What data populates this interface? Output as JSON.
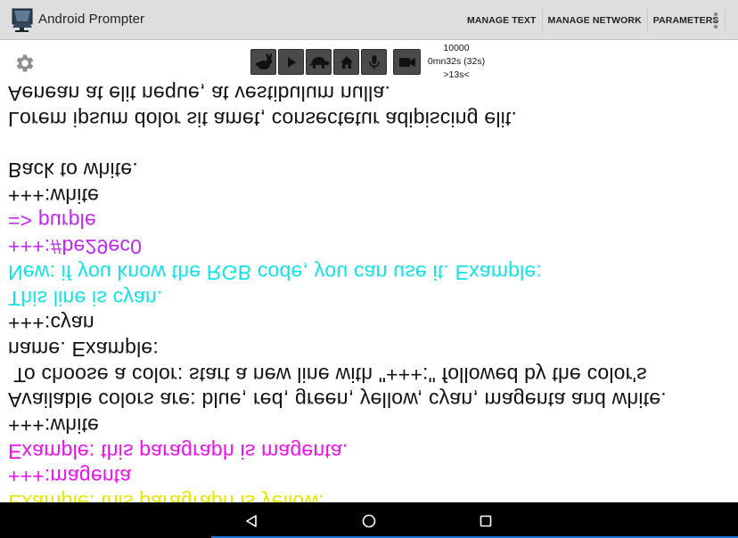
{
  "app": {
    "title": "Android Prompter",
    "icon": "teleprompter-icon"
  },
  "menu": {
    "items": [
      {
        "label": "MANAGE TEXT"
      },
      {
        "label": "MANAGE NETWORK"
      },
      {
        "label": "PARAMETERS"
      }
    ],
    "overflow_icon": "overflow-menu-icon"
  },
  "toolbar": {
    "settings_icon": "gear-icon",
    "buttons": [
      {
        "name": "speed-up-button",
        "icon": "rabbit-icon"
      },
      {
        "name": "play-button",
        "icon": "play-icon"
      },
      {
        "name": "slow-down-button",
        "icon": "turtle-icon"
      },
      {
        "name": "home-button",
        "icon": "home-icon"
      },
      {
        "name": "microphone-button",
        "icon": "microphone-icon"
      },
      {
        "name": "camera-button",
        "icon": "video-camera-icon"
      }
    ]
  },
  "stats": {
    "speed": "10000",
    "duration": "0mn32s (32s)",
    "remaining": ">13s<"
  },
  "prompter": {
    "mirrored": true,
    "lines": [
      {
        "text": "Aenean at elit neque, at vestibulum nulla.",
        "color": "black"
      },
      {
        "text": "Lorem ipsum dolor sit amet, consectetur adipiscing elit.",
        "color": "black"
      },
      {
        "text": "",
        "color": "black"
      },
      {
        "text": "Back to white.",
        "color": "black"
      },
      {
        "text": "+++:white",
        "color": "black"
      },
      {
        "text": "=> purple",
        "color": "purple"
      },
      {
        "text": "+++:#be29ec0",
        "color": "purple"
      },
      {
        "text": "New: if you know the RGB code, you can use it. Example:",
        "color": "cyan"
      },
      {
        "text": "This line is cyan.",
        "color": "cyan"
      },
      {
        "text": "+++:cyan",
        "color": "black"
      },
      {
        "text": "name. Example:",
        "color": "black"
      },
      {
        "text": " To choose a color: start a new line with \"+++:\" followed by the color's",
        "color": "black"
      },
      {
        "text": "Available colors are: blue, red, green, yellow, cyan, magenta and white.",
        "color": "black"
      },
      {
        "text": "+++:white",
        "color": "black"
      },
      {
        "text": "Example: this paragraph is magenta.",
        "color": "magenta"
      },
      {
        "text": "+++:magenta",
        "color": "magenta"
      },
      {
        "text": "Example: this paragraph is yellow.",
        "color": "yellow"
      }
    ]
  },
  "colors": {
    "black": "#111111",
    "magenta": "#ee10ee",
    "cyan": "#12e2e6",
    "purple": "#be29ec",
    "yellow": "#e6e600",
    "actionbar": "#dedede",
    "button": "#4a4a4a"
  },
  "navbar": {
    "back_icon": "back-triangle-icon",
    "home_icon": "home-circle-icon",
    "recents_icon": "recents-square-icon"
  }
}
